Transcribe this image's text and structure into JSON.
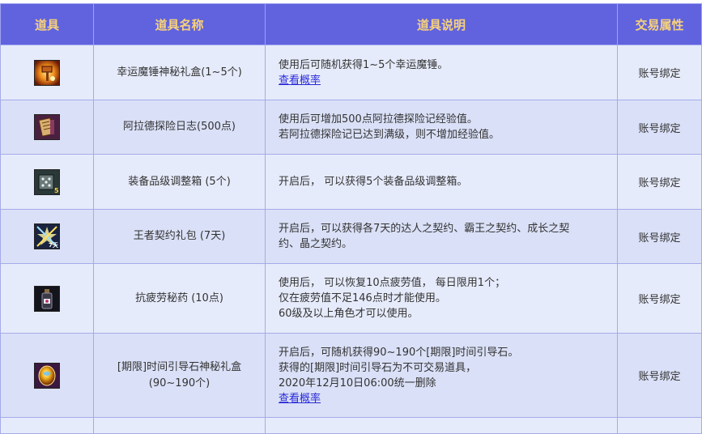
{
  "headers": {
    "icon": "道具",
    "name": "道具名称",
    "desc": "道具说明",
    "trade": "交易属性"
  },
  "rows": [
    {
      "icon": "lucky-hammer-box-icon",
      "name": [
        "幸运魔锤神秘礼盒(1~5个)"
      ],
      "desc": [
        "使用后可随机获得1~5个幸运魔锤。"
      ],
      "link": "查看概率",
      "trade": "账号绑定"
    },
    {
      "icon": "arad-journal-icon",
      "name": [
        "阿拉德探险日志(500点)"
      ],
      "desc": [
        "使用后可增加500点阿拉德探险记经验值。",
        "若阿拉德探险记已达到满级，则不增加经验值。"
      ],
      "trade": "账号绑定"
    },
    {
      "icon": "grade-adjust-box-icon",
      "name": [
        "装备品级调整箱 (5个)"
      ],
      "desc": [
        "开启后， 可以获得5个装备品级调整箱。"
      ],
      "trade": "账号绑定"
    },
    {
      "icon": "king-contract-icon",
      "name": [
        "王者契约礼包 (7天)"
      ],
      "desc": [
        "开启后，可以获得各7天的达人之契约、霸王之契约、成长之契",
        "约、晶之契约。"
      ],
      "trade": "账号绑定"
    },
    {
      "icon": "fatigue-potion-icon",
      "name": [
        "抗疲劳秘药 (10点)"
      ],
      "desc": [
        "使用后， 可以恢复10点疲劳值， 每日限用1个；",
        "仅在疲劳值不足146点时才能使用。",
        "60级及以上角色才可以使用。"
      ],
      "trade": "账号绑定"
    },
    {
      "icon": "time-guide-stone-box-icon",
      "name": [
        "[期限]时间引导石神秘礼盒",
        "(90~190个)"
      ],
      "desc": [
        "开启后，可随机获得90~190个[期限]时间引导石。",
        "获得的[期限]时间引导石为不可交易道具，",
        "2020年12月10日06:00统一删除"
      ],
      "link": "查看概率",
      "trade": "账号绑定"
    }
  ]
}
